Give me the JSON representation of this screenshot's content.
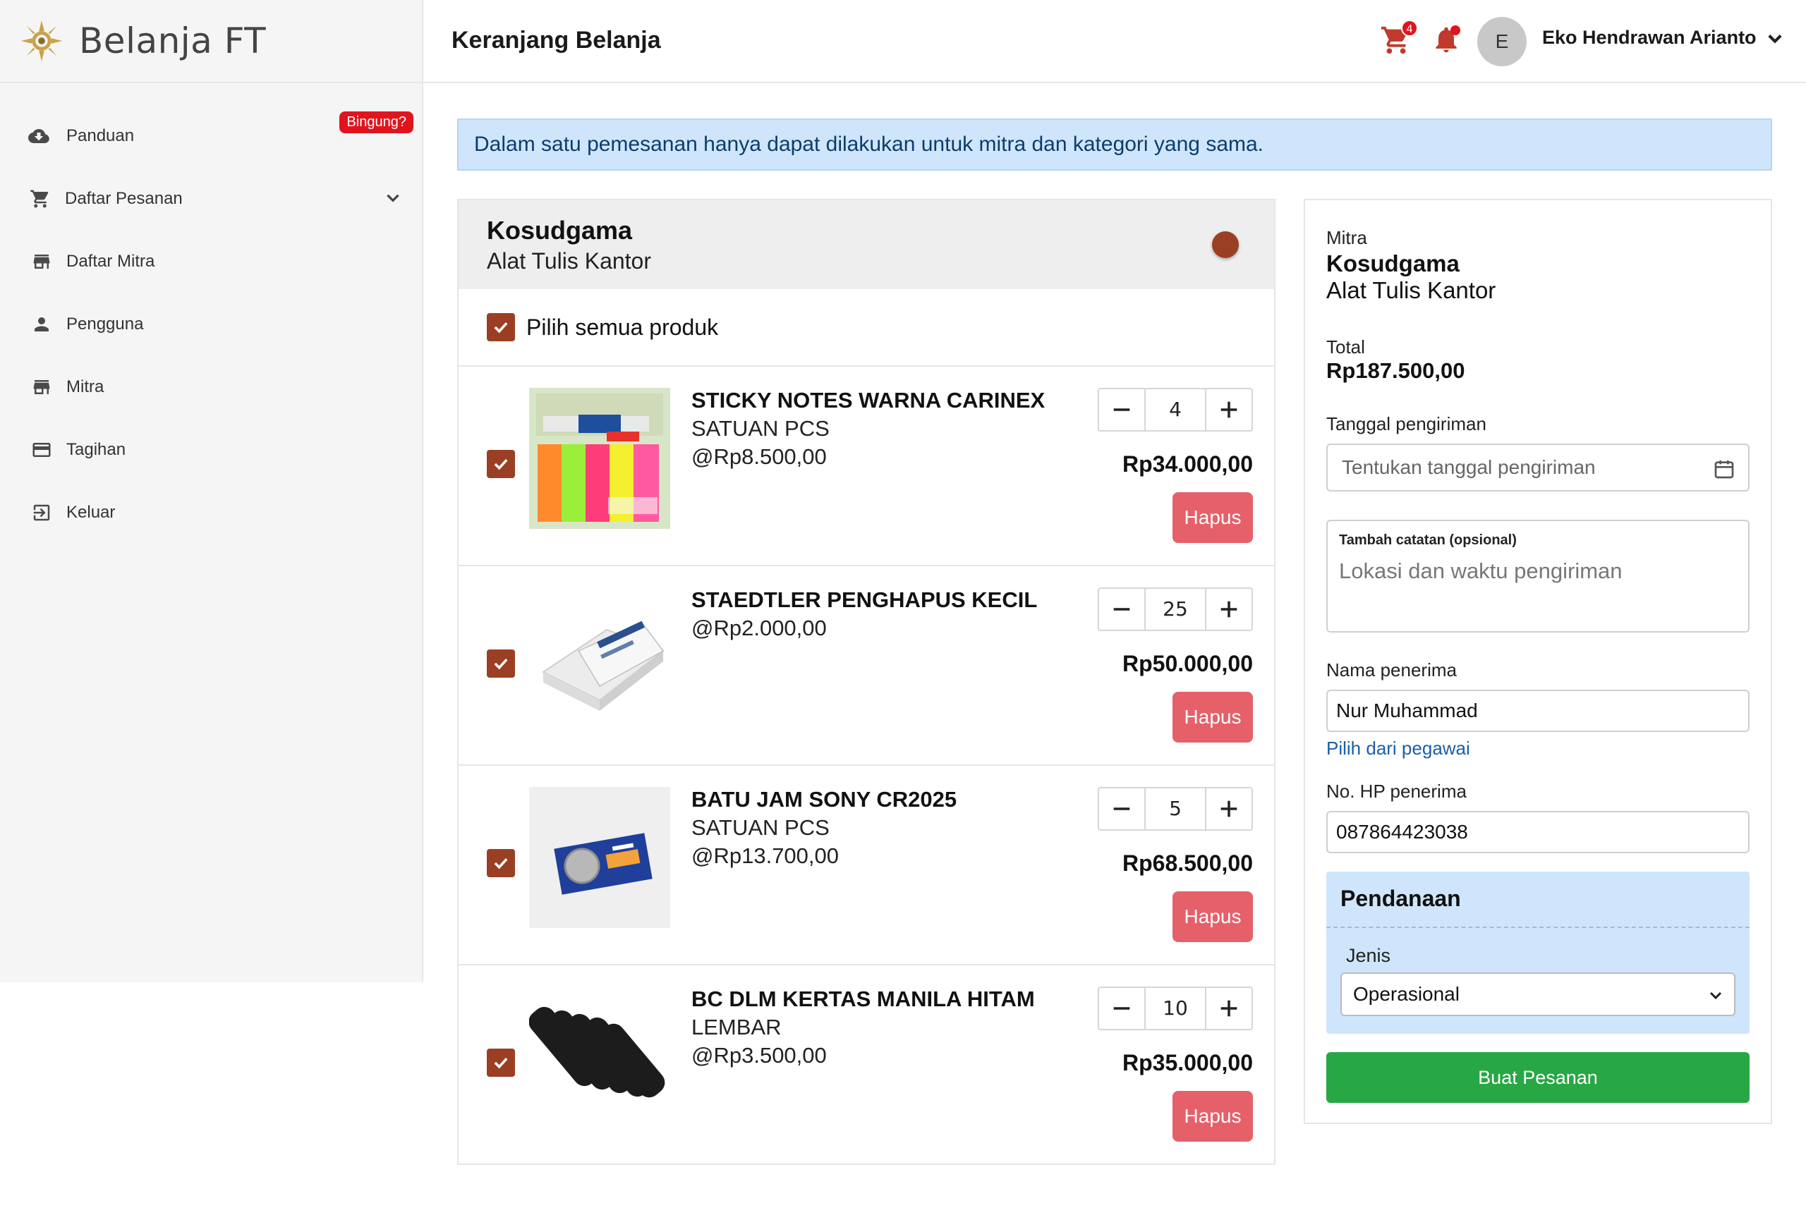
{
  "brand": {
    "title": "Belanja FT"
  },
  "sidebar": {
    "items": [
      {
        "label": "Panduan",
        "icon": "cloud-download-icon",
        "badge": "Bingung?"
      },
      {
        "label": "Daftar Pesanan",
        "icon": "cart-icon",
        "expandable": true
      },
      {
        "label": "Daftar Mitra",
        "icon": "store-icon"
      },
      {
        "label": "Pengguna",
        "icon": "person-icon"
      },
      {
        "label": "Mitra",
        "icon": "store-icon"
      },
      {
        "label": "Tagihan",
        "icon": "credit-card-icon"
      },
      {
        "label": "Keluar",
        "icon": "logout-icon"
      }
    ]
  },
  "header": {
    "title": "Keranjang Belanja",
    "cart_count": "4",
    "avatar_initial": "E",
    "user_name": "Eko Hendrawan Arianto"
  },
  "banner": {
    "text": "Dalam satu pemesanan hanya dapat dilakukan untuk mitra dan kategori yang sama."
  },
  "cart": {
    "vendor": "Kosudgama",
    "category": "Alat Tulis Kantor",
    "select_all_label": "Pilih semua produk",
    "delete_label": "Hapus",
    "items": [
      {
        "name": "STICKY NOTES WARNA CARINEX",
        "unit": "SATUAN PCS",
        "unit_price": "@Rp8.500,00",
        "qty": "4",
        "total": "Rp34.000,00",
        "checked": true
      },
      {
        "name": "STAEDTLER PENGHAPUS KECIL",
        "unit": "",
        "unit_price": "@Rp2.000,00",
        "qty": "25",
        "total": "Rp50.000,00",
        "checked": true
      },
      {
        "name": "BATU JAM SONY CR2025",
        "unit": "SATUAN PCS",
        "unit_price": "@Rp13.700,00",
        "qty": "5",
        "total": "Rp68.500,00",
        "checked": true
      },
      {
        "name": "BC DLM KERTAS MANILA HITAM",
        "unit": "LEMBAR",
        "unit_price": "@Rp3.500,00",
        "qty": "10",
        "total": "Rp35.000,00",
        "checked": true
      }
    ]
  },
  "checkout": {
    "mitra_label": "Mitra",
    "vendor": "Kosudgama",
    "category": "Alat Tulis Kantor",
    "total_label": "Total",
    "total": "Rp187.500,00",
    "date_label": "Tanggal pengiriman",
    "date_placeholder": "Tentukan tanggal pengiriman",
    "note_label": "Tambah catatan (opsional)",
    "note_placeholder": "Lokasi dan waktu pengiriman",
    "recipient_label": "Nama penerima",
    "recipient_value": "Nur Muhammad",
    "pick_employee_link": "Pilih dari pegawai",
    "phone_label": "No. HP penerima",
    "phone_value": "087864423038",
    "funding_title": "Pendanaan",
    "funding_type_label": "Jenis",
    "funding_type_value": "Operasional",
    "submit_label": "Buat Pesanan"
  },
  "colors": {
    "accent": "#9b3f24",
    "danger": "#e6606a",
    "success": "#28a745",
    "info_bg": "#cfe5fb",
    "link": "#1a5ea8"
  }
}
